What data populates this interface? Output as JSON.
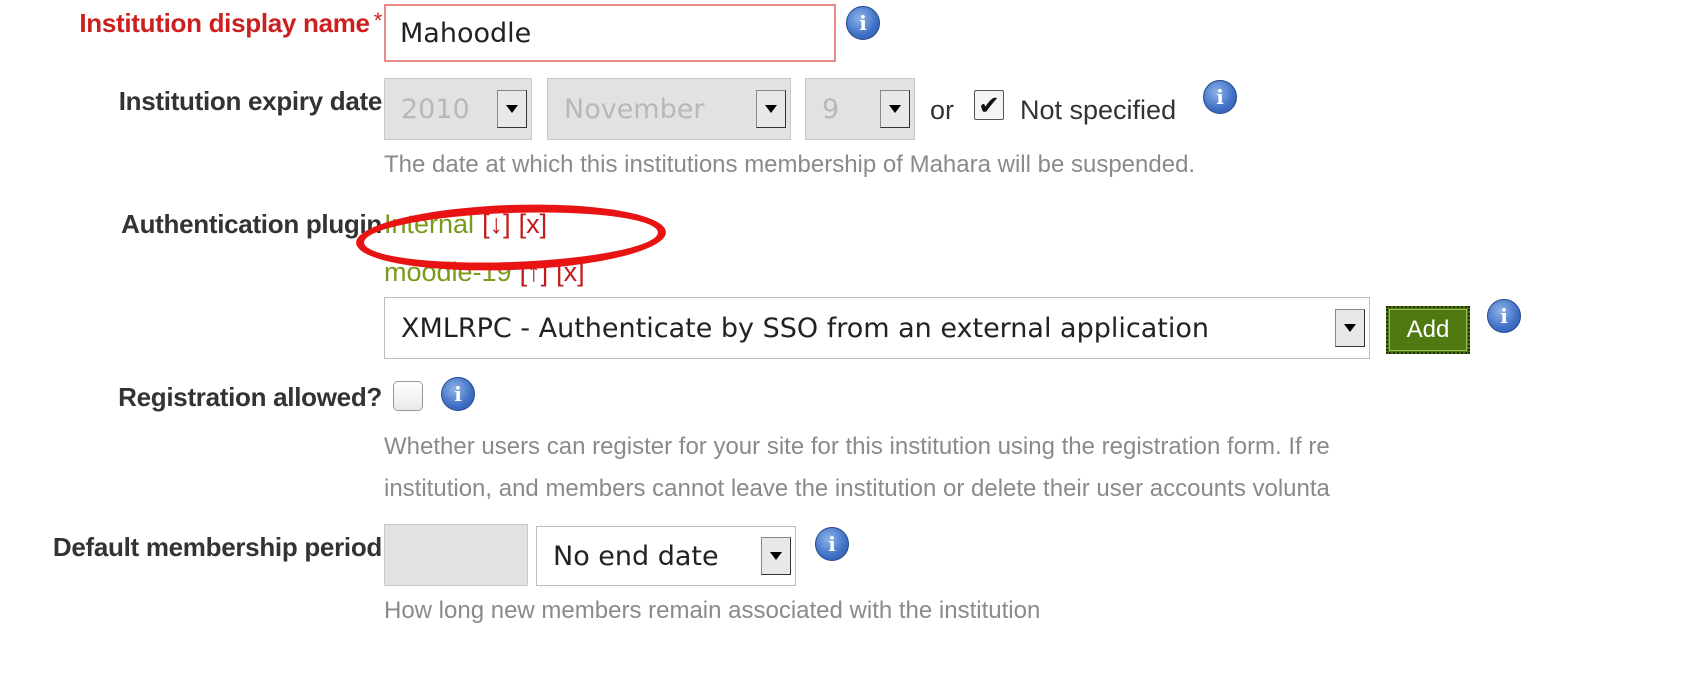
{
  "form": {
    "display_name": {
      "label": "Institution display name",
      "required_marker": "*",
      "value": "Mahoodle"
    },
    "expiry_date": {
      "label": "Institution expiry date",
      "year": "2010",
      "month": "November",
      "day": "9",
      "or_text": "or",
      "not_specified_label": "Not specified",
      "not_specified_checked": true,
      "help": "The date at which this institutions membership of Mahara will be suspended."
    },
    "auth_plugin": {
      "label": "Authentication plugin",
      "plugins": [
        {
          "name": "Internal",
          "move": "[↓]",
          "remove": "[x]"
        },
        {
          "name": "moodle-19",
          "move": "[↑]",
          "remove": "[x]"
        }
      ],
      "select_value": "XMLRPC - Authenticate by SSO from an external application",
      "add_label": "Add"
    },
    "registration": {
      "label": "Registration allowed?",
      "checked": false,
      "help_line1": "Whether users can register for your site for this institution using the registration form. If re",
      "help_line2": "institution, and members cannot leave the institution or delete their user accounts volunta"
    },
    "membership_period": {
      "label": "Default membership period",
      "value": "",
      "unit": "No end date",
      "help": "How long new members remain associated with the institution"
    },
    "info_icon_glyph": "i"
  },
  "colors": {
    "required_label": "#cc1f1f",
    "plugin_name": "#7a9a1a",
    "plugin_controls": "#c21a1a",
    "add_button": "#4f7a12",
    "annotation_circle": "#e81414",
    "help_text": "#8a8a8a"
  }
}
